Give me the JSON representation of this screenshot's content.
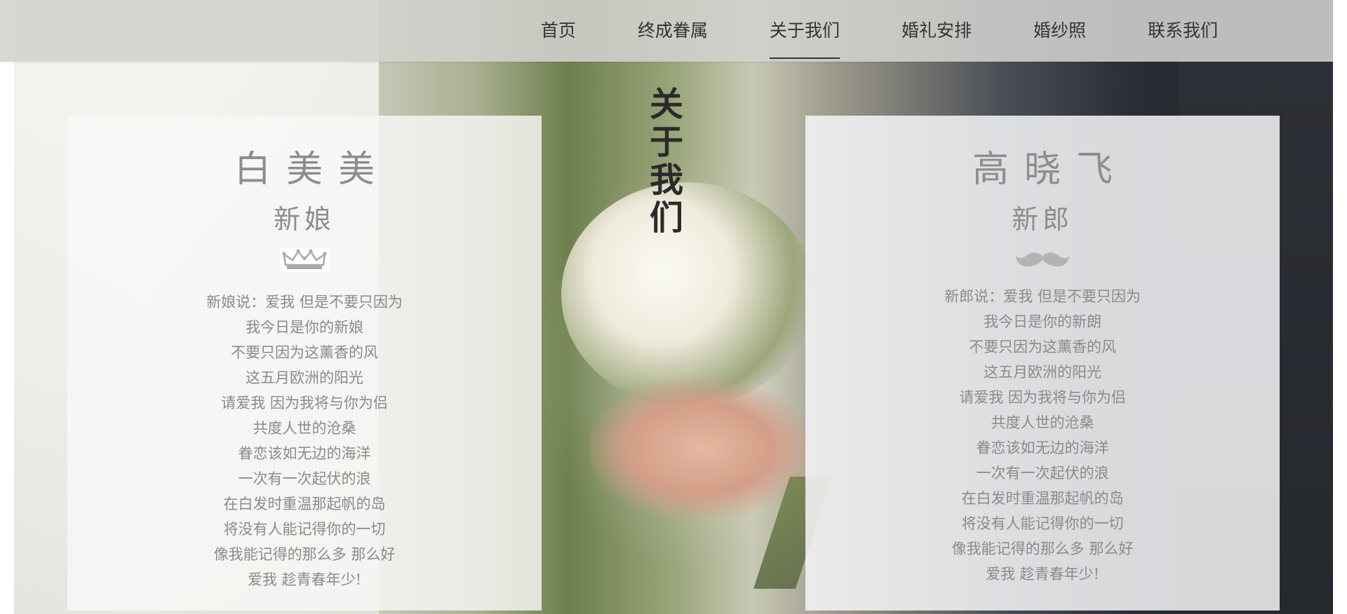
{
  "nav": {
    "items": [
      {
        "label": "首页",
        "active": false
      },
      {
        "label": "终成眷属",
        "active": false
      },
      {
        "label": "关于我们",
        "active": true
      },
      {
        "label": "婚礼安排",
        "active": false
      },
      {
        "label": "婚纱照",
        "active": false
      },
      {
        "label": "联系我们",
        "active": false
      }
    ]
  },
  "heading": "关于我们",
  "bride": {
    "name": "白美美",
    "role": "新娘",
    "emblem_icon": "crown-icon",
    "poem": [
      "新娘说：爱我  但是不要只因为",
      "我今日是你的新娘",
      "不要只因为这薰香的风",
      "这五月欧洲的阳光",
      "请爱我  因为我将与你为侣",
      "共度人世的沧桑",
      "眷恋该如无边的海洋",
      "一次有一次起伏的浪",
      "在白发时重温那起帆的岛",
      "将没有人能记得你的一切",
      "像我能记得的那么多  那么好",
      "爱我  趁青春年少!"
    ]
  },
  "groom": {
    "name": "高晓飞",
    "role": "新郎",
    "emblem_icon": "mustache-icon",
    "poem": [
      "新郎说：爱我  但是不要只因为",
      "我今日是你的新朗",
      "不要只因为这薰香的风",
      "这五月欧洲的阳光",
      "请爱我  因为我将与你为侣",
      "共度人世的沧桑",
      "眷恋该如无边的海洋",
      "一次有一次起伏的浪",
      "在白发时重温那起帆的岛",
      "将没有人能记得你的一切",
      "像我能记得的那么多  那么好",
      "爱我  趁青春年少!"
    ]
  }
}
